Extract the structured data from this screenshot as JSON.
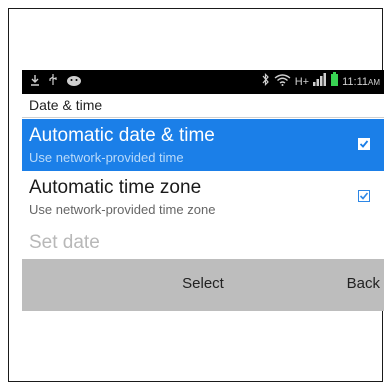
{
  "status_bar": {
    "time": "11:11",
    "ampm": "AM",
    "left_icons": [
      "download-icon",
      "usb-icon",
      "android-debug-icon"
    ],
    "right_icons": [
      "bluetooth-icon",
      "wifi-icon",
      "signal-icon",
      "battery-icon"
    ],
    "network_label": "H+"
  },
  "title_bar": {
    "title": "Date & time"
  },
  "settings": [
    {
      "title": "Automatic date & time",
      "subtitle": "Use network-provided time",
      "checked": true,
      "selected": true
    },
    {
      "title": "Automatic time zone",
      "subtitle": "Use network-provided time zone",
      "checked": true,
      "selected": false
    },
    {
      "title": "Set date"
    }
  ],
  "softkeys": {
    "center": "Select",
    "right": "Back"
  },
  "colors": {
    "accent": "#1b7fe8",
    "softkey_bg": "#bdbdbd",
    "statusbar_bg": "#000000"
  }
}
